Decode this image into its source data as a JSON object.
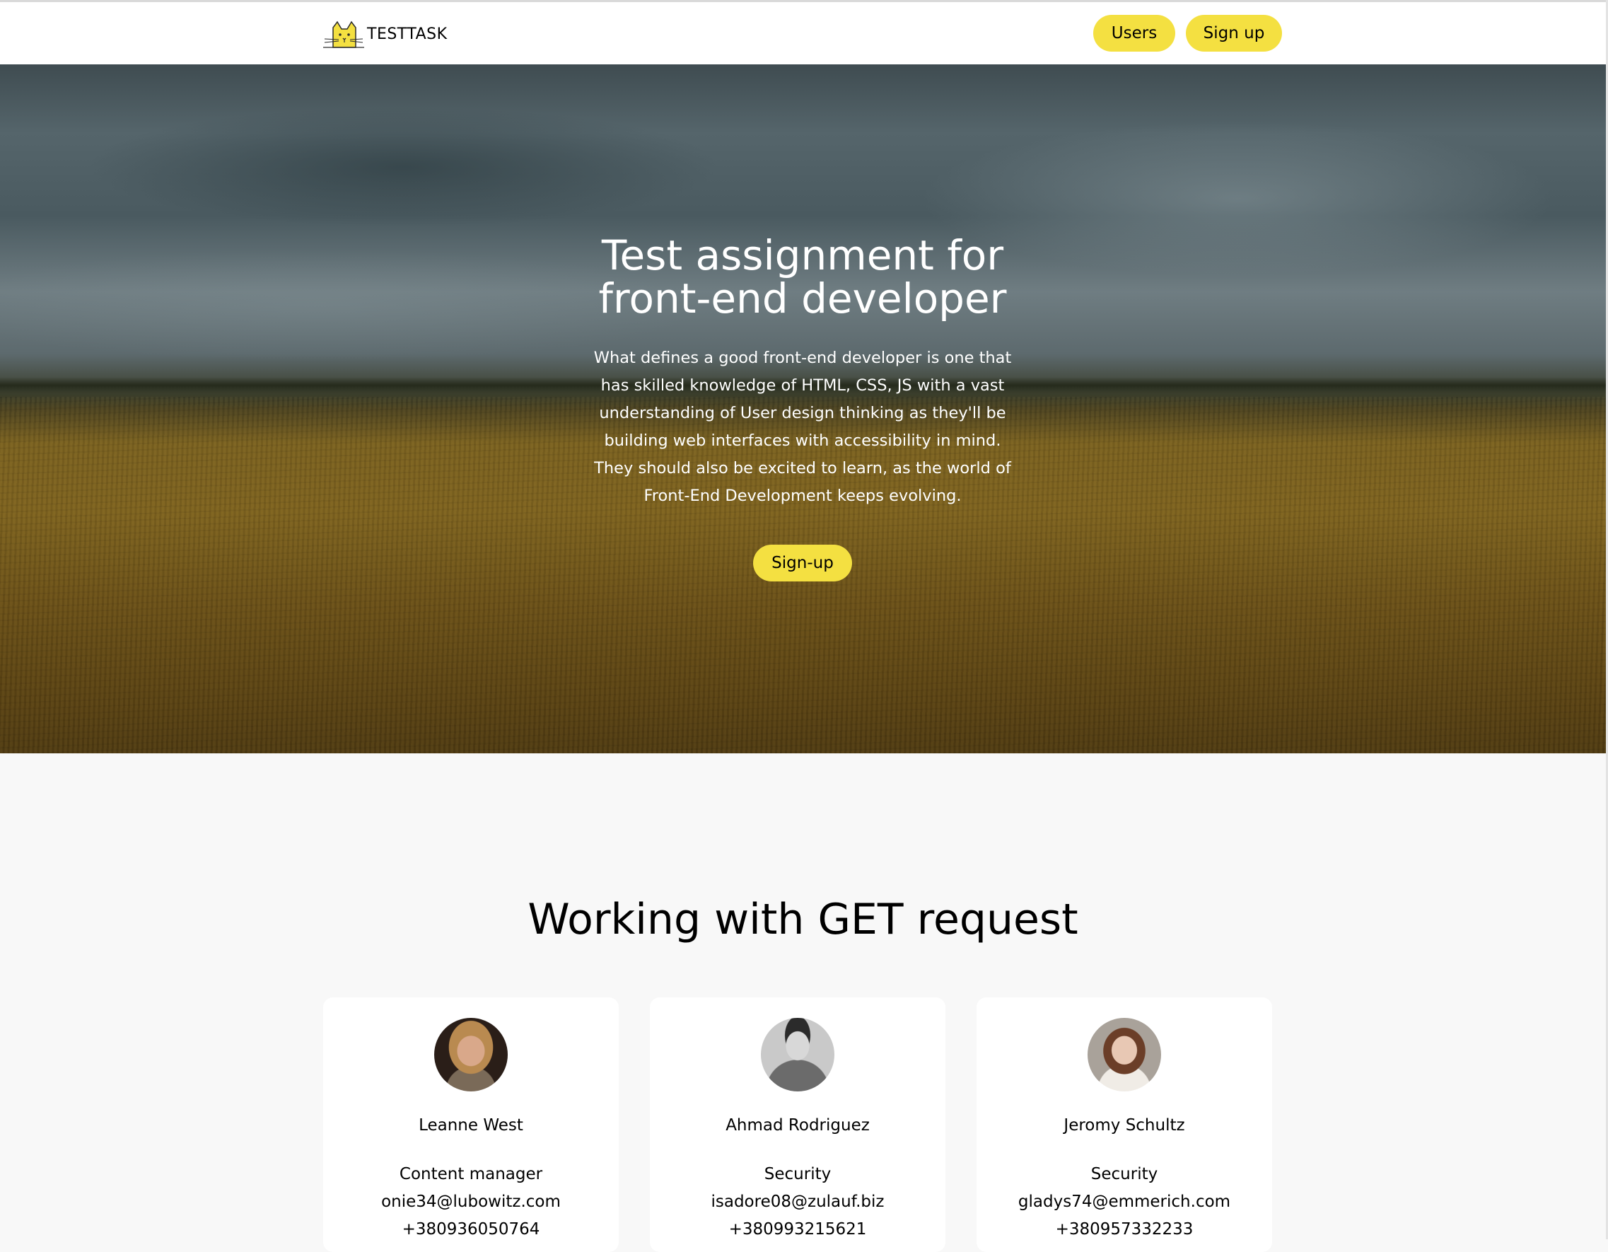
{
  "header": {
    "logo_text": "TESTTASK",
    "nav": {
      "users_label": "Users",
      "signup_label": "Sign up"
    }
  },
  "hero": {
    "title_line1": "Test assignment for",
    "title_line2": "front-end developer",
    "description": "What defines a good front-end developer is one that has skilled knowledge of HTML, CSS, JS with a vast understanding of User design thinking as they'll be building web interfaces with accessibility in mind. They should also be excited to learn, as the world of Front-End Development keeps evolving.",
    "cta_label": "Sign-up"
  },
  "users_section": {
    "title": "Working with GET request",
    "users": [
      {
        "name": "Leanne West",
        "position": "Content manager",
        "email": "onie34@lubowitz.com",
        "phone": "+380936050764"
      },
      {
        "name": "Ahmad Rodriguez",
        "position": "Security",
        "email": "isadore08@zulauf.biz",
        "phone": "+380993215621"
      },
      {
        "name": "Jeromy Schultz",
        "position": "Security",
        "email": "gladys74@emmerich.com",
        "phone": "+380957332233"
      }
    ]
  },
  "colors": {
    "accent": "#f4e041",
    "page_background": "#f8f8f8",
    "card_background": "#ffffff",
    "text": "#000000"
  },
  "icons": {
    "logo": "cat-logo-icon"
  }
}
